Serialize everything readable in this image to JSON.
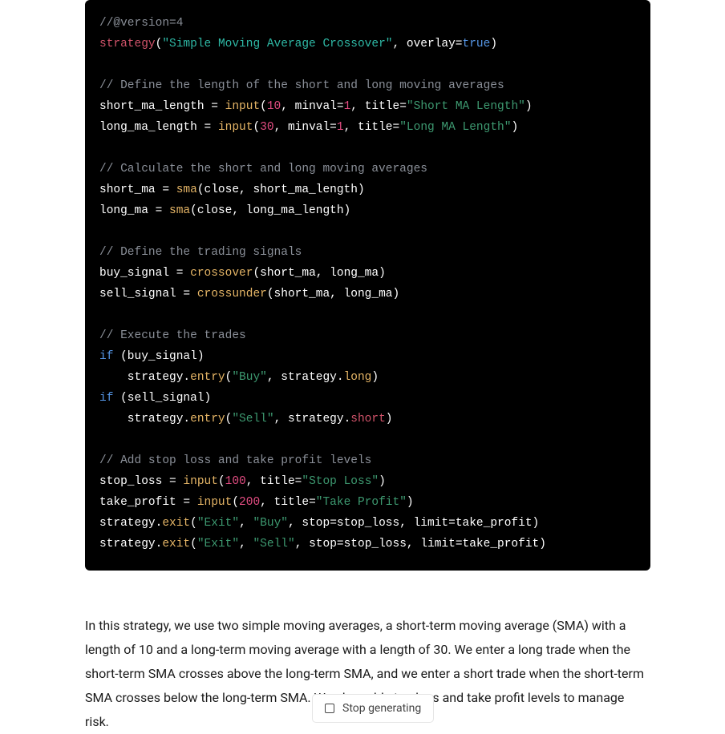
{
  "code": {
    "lines": [
      {
        "t": "comment",
        "v": "//@version=4"
      },
      {
        "t": "mixed",
        "parts": [
          {
            "c": "keyword-red",
            "v": "strategy"
          },
          {
            "c": "white",
            "v": "("
          },
          {
            "c": "string-teal",
            "v": "\"Simple Moving Average Crossover\""
          },
          {
            "c": "white",
            "v": ", overlay="
          },
          {
            "c": "prop-blue",
            "v": "true"
          },
          {
            "c": "white",
            "v": ")"
          }
        ]
      },
      {
        "t": "blank"
      },
      {
        "t": "comment",
        "v": "// Define the length of the short and long moving averages"
      },
      {
        "t": "mixed",
        "parts": [
          {
            "c": "white",
            "v": "short_ma_length = "
          },
          {
            "c": "func-yellow",
            "v": "input"
          },
          {
            "c": "white",
            "v": "("
          },
          {
            "c": "number-pink",
            "v": "10"
          },
          {
            "c": "white",
            "v": ", minval="
          },
          {
            "c": "number-pink",
            "v": "1"
          },
          {
            "c": "white",
            "v": ", title="
          },
          {
            "c": "string-green",
            "v": "\"Short MA Length\""
          },
          {
            "c": "white",
            "v": ")"
          }
        ]
      },
      {
        "t": "mixed",
        "parts": [
          {
            "c": "white",
            "v": "long_ma_length = "
          },
          {
            "c": "func-yellow",
            "v": "input"
          },
          {
            "c": "white",
            "v": "("
          },
          {
            "c": "number-pink",
            "v": "30"
          },
          {
            "c": "white",
            "v": ", minval="
          },
          {
            "c": "number-pink",
            "v": "1"
          },
          {
            "c": "white",
            "v": ", title="
          },
          {
            "c": "string-green",
            "v": "\"Long MA Length\""
          },
          {
            "c": "white",
            "v": ")"
          }
        ]
      },
      {
        "t": "blank"
      },
      {
        "t": "comment",
        "v": "// Calculate the short and long moving averages"
      },
      {
        "t": "mixed",
        "parts": [
          {
            "c": "white",
            "v": "short_ma = "
          },
          {
            "c": "func-yellow",
            "v": "sma"
          },
          {
            "c": "white",
            "v": "(close, short_ma_length)"
          }
        ]
      },
      {
        "t": "mixed",
        "parts": [
          {
            "c": "white",
            "v": "long_ma = "
          },
          {
            "c": "func-yellow",
            "v": "sma"
          },
          {
            "c": "white",
            "v": "(close, long_ma_length)"
          }
        ]
      },
      {
        "t": "blank"
      },
      {
        "t": "comment",
        "v": "// Define the trading signals"
      },
      {
        "t": "mixed",
        "parts": [
          {
            "c": "white",
            "v": "buy_signal = "
          },
          {
            "c": "func-yellow",
            "v": "crossover"
          },
          {
            "c": "white",
            "v": "(short_ma, long_ma)"
          }
        ]
      },
      {
        "t": "mixed",
        "parts": [
          {
            "c": "white",
            "v": "sell_signal = "
          },
          {
            "c": "func-yellow",
            "v": "crossunder"
          },
          {
            "c": "white",
            "v": "(short_ma, long_ma)"
          }
        ]
      },
      {
        "t": "blank"
      },
      {
        "t": "comment",
        "v": "// Execute the trades"
      },
      {
        "t": "mixed",
        "parts": [
          {
            "c": "prop-blue",
            "v": "if"
          },
          {
            "c": "white",
            "v": " (buy_signal)"
          }
        ]
      },
      {
        "t": "mixed",
        "parts": [
          {
            "c": "white",
            "v": "    strategy."
          },
          {
            "c": "func-yellow",
            "v": "entry"
          },
          {
            "c": "white",
            "v": "("
          },
          {
            "c": "string-green",
            "v": "\"Buy\""
          },
          {
            "c": "white",
            "v": ", strategy."
          },
          {
            "c": "func-yellow",
            "v": "long"
          },
          {
            "c": "white",
            "v": ")"
          }
        ]
      },
      {
        "t": "mixed",
        "parts": [
          {
            "c": "prop-blue",
            "v": "if"
          },
          {
            "c": "white",
            "v": " (sell_signal)"
          }
        ]
      },
      {
        "t": "mixed",
        "parts": [
          {
            "c": "white",
            "v": "    strategy."
          },
          {
            "c": "func-yellow",
            "v": "entry"
          },
          {
            "c": "white",
            "v": "("
          },
          {
            "c": "string-green",
            "v": "\"Sell\""
          },
          {
            "c": "white",
            "v": ", strategy."
          },
          {
            "c": "keyword-red",
            "v": "short"
          },
          {
            "c": "white",
            "v": ")"
          }
        ]
      },
      {
        "t": "blank"
      },
      {
        "t": "comment",
        "v": "// Add stop loss and take profit levels"
      },
      {
        "t": "mixed",
        "parts": [
          {
            "c": "white",
            "v": "stop_loss = "
          },
          {
            "c": "func-yellow",
            "v": "input"
          },
          {
            "c": "white",
            "v": "("
          },
          {
            "c": "number-pink",
            "v": "100"
          },
          {
            "c": "white",
            "v": ", title="
          },
          {
            "c": "string-green",
            "v": "\"Stop Loss\""
          },
          {
            "c": "white",
            "v": ")"
          }
        ]
      },
      {
        "t": "mixed",
        "parts": [
          {
            "c": "white",
            "v": "take_profit = "
          },
          {
            "c": "func-yellow",
            "v": "input"
          },
          {
            "c": "white",
            "v": "("
          },
          {
            "c": "number-pink",
            "v": "200"
          },
          {
            "c": "white",
            "v": ", title="
          },
          {
            "c": "string-green",
            "v": "\"Take Profit\""
          },
          {
            "c": "white",
            "v": ")"
          }
        ]
      },
      {
        "t": "mixed",
        "parts": [
          {
            "c": "white",
            "v": "strategy."
          },
          {
            "c": "func-yellow",
            "v": "exit"
          },
          {
            "c": "white",
            "v": "("
          },
          {
            "c": "string-green",
            "v": "\"Exit\""
          },
          {
            "c": "white",
            "v": ", "
          },
          {
            "c": "string-green",
            "v": "\"Buy\""
          },
          {
            "c": "white",
            "v": ", stop=stop_loss, limit=take_profit)"
          }
        ]
      },
      {
        "t": "mixed",
        "parts": [
          {
            "c": "white",
            "v": "strategy."
          },
          {
            "c": "func-yellow",
            "v": "exit"
          },
          {
            "c": "white",
            "v": "("
          },
          {
            "c": "string-green",
            "v": "\"Exit\""
          },
          {
            "c": "white",
            "v": ", "
          },
          {
            "c": "string-green",
            "v": "\"Sell\""
          },
          {
            "c": "white",
            "v": ", stop=stop_loss, limit=take_profit)"
          }
        ]
      }
    ]
  },
  "explanation": "In this strategy, we use two simple moving averages, a short-term moving average (SMA) with a length of 10 and a long-term moving average with a length of 30. We enter a long trade when the short-term SMA crosses above the long-term SMA, and we enter a short trade when the short-term SMA crosses below the long-term SMA. We also add stop loss and take profit levels to manage risk.",
  "button": {
    "stop_label": "Stop generating"
  }
}
